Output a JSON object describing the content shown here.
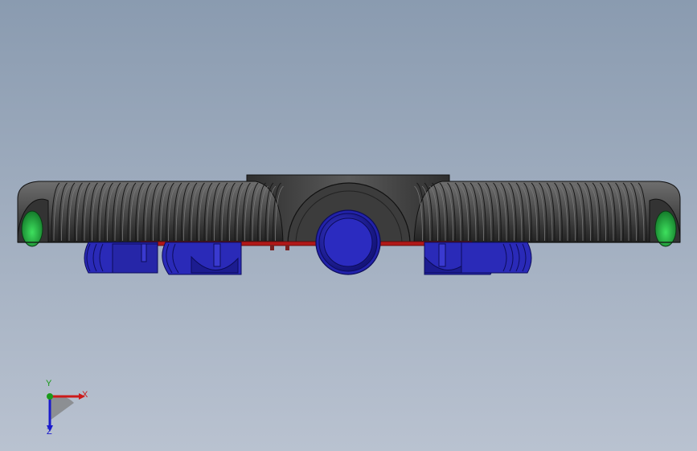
{
  "viewport": {
    "background_top": "#8a9bb0",
    "background_bottom": "#b9c2d0"
  },
  "model": {
    "name": "tracked-vehicle-assembly",
    "colors": {
      "track": "#4a4a4a",
      "track_dark": "#222222",
      "track_light": "#6e6e6e",
      "hub": "#3a3a3a",
      "wheel_blue": "#2a2ab8",
      "wheel_blue_dark": "#14147a",
      "wheel_green": "#2ec24a",
      "chassis_red": "#b01818"
    }
  },
  "triad": {
    "x_label": "X",
    "y_label": "Y",
    "z_label": "Z",
    "x_color": "#cc1a1a",
    "y_color": "#1a9a1a",
    "z_color": "#1a1acc"
  }
}
